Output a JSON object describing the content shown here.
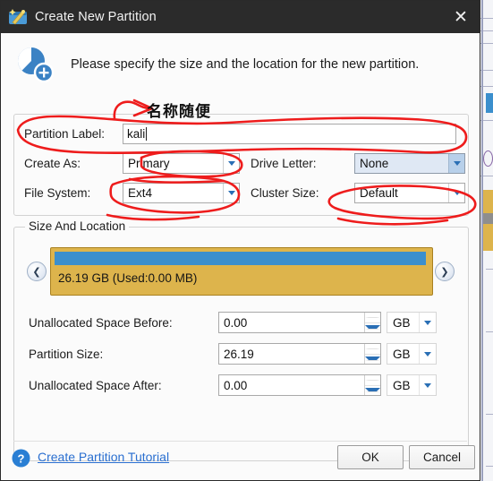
{
  "window": {
    "title": "Create New Partition",
    "app_icon": "partition-wizard-icon",
    "close_icon": "close-icon"
  },
  "intro": {
    "icon": "new-partition-pie-icon",
    "text": "Please specify the size and the location for the new partition."
  },
  "basic_group": {
    "partition_label": {
      "label": "Partition Label:",
      "value": "kali"
    },
    "create_as": {
      "label": "Create As:",
      "value": "Primary"
    },
    "drive_letter": {
      "label": "Drive Letter:",
      "value": "None"
    },
    "file_system": {
      "label": "File System:",
      "value": "Ext4"
    },
    "cluster_size": {
      "label": "Cluster Size:",
      "value": "Default"
    }
  },
  "size_group": {
    "legend": "Size And Location",
    "nav_left_icon": "chevron-left-icon",
    "nav_right_icon": "chevron-right-icon",
    "partition_bar": {
      "text": "26.19 GB (Used:0.00 MB)",
      "total_gb": "26.19",
      "used": "0.00 MB"
    },
    "rows": [
      {
        "label": "Unallocated Space Before:",
        "value": "0.00",
        "unit": "GB"
      },
      {
        "label": "Partition Size:",
        "value": "26.19",
        "unit": "GB"
      },
      {
        "label": "Unallocated Space After:",
        "value": "0.00",
        "unit": "GB"
      }
    ]
  },
  "footer": {
    "help_icon": "help-question-icon",
    "tutorial_link": "Create Partition Tutorial",
    "ok_label": "OK",
    "cancel_label": "Cancel"
  },
  "annotation": {
    "note_text": "名称随便",
    "ink_color": "#ee1c1c"
  },
  "colors": {
    "titlebar": "#2b2b2b",
    "partition_used": "#3b8fcd",
    "partition_block": "#ddb44c",
    "link": "#2a6fd0",
    "accent_arrow": "#2a6fb5"
  }
}
